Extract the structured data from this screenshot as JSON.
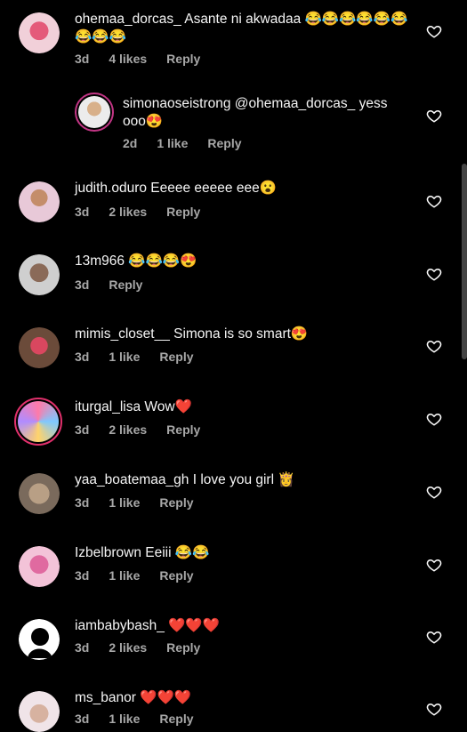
{
  "comments": [
    {
      "text": "ohemaa_dorcas_ Asante ni akwadaa 😂😂😂😂😂😂😂😂😂",
      "time": "3d",
      "likes": "4 likes",
      "reply": "Reply"
    },
    {
      "text": "simonaoseistrong @ohemaa_dorcas_ yess ooo😍",
      "time": "2d",
      "likes": "1 like",
      "reply": "Reply"
    },
    {
      "text": "judith.oduro Eeeee eeeee eee😮",
      "time": "3d",
      "likes": "2 likes",
      "reply": "Reply"
    },
    {
      "text": "13m966 😂😂😂😍",
      "time": "3d",
      "likes": "",
      "reply": "Reply"
    },
    {
      "text": "mimis_closet__ Simona is so smart😍",
      "time": "3d",
      "likes": "1 like",
      "reply": "Reply"
    },
    {
      "text": "iturgal_lisa Wow❤️",
      "time": "3d",
      "likes": "2 likes",
      "reply": "Reply"
    },
    {
      "text": "yaa_boatemaa_gh I love you girl 👸",
      "time": "3d",
      "likes": "1 like",
      "reply": "Reply"
    },
    {
      "text": "Izbelbrown Eeiii 😂😂",
      "time": "3d",
      "likes": "1 like",
      "reply": "Reply"
    },
    {
      "text": "iambabybash_ ❤️❤️❤️",
      "time": "3d",
      "likes": "2 likes",
      "reply": "Reply"
    },
    {
      "text": "ms_banor ❤️❤️❤️",
      "time": "3d",
      "likes": "1 like",
      "reply": "Reply"
    }
  ],
  "colors": {
    "background": "#000000",
    "meta": "#a8a8a8",
    "story_ring": "#c13584"
  },
  "icons": {
    "like": "heart-outline-icon"
  }
}
